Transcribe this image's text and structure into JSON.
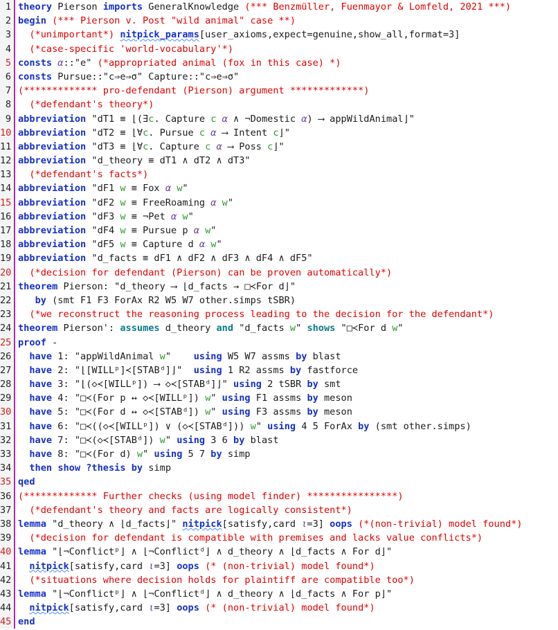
{
  "lines": [
    {
      "n": "1",
      "segs": [
        {
          "t": "theory",
          "c": "kw"
        },
        {
          "t": " Pierson "
        },
        {
          "t": "imports",
          "c": "kw"
        },
        {
          "t": " GeneralKnowledge "
        },
        {
          "t": "(*** Benzmüller, Fuenmayor & Lomfeld, 2021 ***)",
          "c": "cmt"
        }
      ]
    },
    {
      "n": "2",
      "segs": [
        {
          "t": "begin",
          "c": "kw"
        },
        {
          "t": " "
        },
        {
          "t": "(*** Pierson v. Post \"wild animal\" case **)",
          "c": "cmt"
        }
      ]
    },
    {
      "n": "3",
      "segs": [
        {
          "t": "  "
        },
        {
          "t": "(*unimportant*)",
          "c": "cmt"
        },
        {
          "t": " "
        },
        {
          "t": "nitpick_params",
          "c": "kw und"
        },
        {
          "t": "[user_axioms,expect=genuine,show_all,format=3]"
        }
      ]
    },
    {
      "n": "4",
      "segs": [
        {
          "t": "  "
        },
        {
          "t": "(*case-specific 'world-vocabulary'*)",
          "c": "cmt"
        }
      ]
    },
    {
      "n": "5",
      "hl": true,
      "segs": [
        {
          "t": "consts",
          "c": "kw"
        },
        {
          "t": " "
        },
        {
          "t": "α",
          "c": "fix"
        },
        {
          "t": "::\"e\" "
        },
        {
          "t": "(*appropriated animal (fox in this case) *)",
          "c": "cmt"
        }
      ]
    },
    {
      "n": "6",
      "segs": [
        {
          "t": "consts",
          "c": "kw"
        },
        {
          "t": " Pursue::\"c⇒e⇒σ\" Capture::\"c⇒e⇒σ\""
        }
      ]
    },
    {
      "n": "7",
      "segs": [
        {
          "t": "(************* pro-defendant (Pierson) argument *************)",
          "c": "cmt"
        }
      ]
    },
    {
      "n": "8",
      "segs": [
        {
          "t": "  "
        },
        {
          "t": "(*defendant's theory*)",
          "c": "cmt"
        }
      ]
    },
    {
      "n": "9",
      "segs": [
        {
          "t": "abbreviation",
          "c": "kw"
        },
        {
          "t": " \"dT1 ≡ ⌊(∃"
        },
        {
          "t": "c",
          "c": "var"
        },
        {
          "t": ". Capture "
        },
        {
          "t": "c",
          "c": "var"
        },
        {
          "t": " "
        },
        {
          "t": "α",
          "c": "fix"
        },
        {
          "t": " ∧ ¬Domestic "
        },
        {
          "t": "α",
          "c": "fix"
        },
        {
          "t": ") ⟶ appWildAnimal⌋\""
        }
      ]
    },
    {
      "n": "10",
      "hl": true,
      "segs": [
        {
          "t": "abbreviation",
          "c": "kw"
        },
        {
          "t": " \"dT2 ≡ ⌊∀"
        },
        {
          "t": "c",
          "c": "var"
        },
        {
          "t": ". Pursue "
        },
        {
          "t": "c",
          "c": "var"
        },
        {
          "t": " "
        },
        {
          "t": "α",
          "c": "fix"
        },
        {
          "t": " ⟶ Intent "
        },
        {
          "t": "c",
          "c": "var"
        },
        {
          "t": "⌋\""
        }
      ]
    },
    {
      "n": "11",
      "segs": [
        {
          "t": "abbreviation",
          "c": "kw"
        },
        {
          "t": " \"dT3 ≡ ⌊∀"
        },
        {
          "t": "c",
          "c": "var"
        },
        {
          "t": ". Capture "
        },
        {
          "t": "c",
          "c": "var"
        },
        {
          "t": " "
        },
        {
          "t": "α",
          "c": "fix"
        },
        {
          "t": " ⟶ Poss "
        },
        {
          "t": "c",
          "c": "var"
        },
        {
          "t": "⌋\""
        }
      ]
    },
    {
      "n": "12",
      "segs": [
        {
          "t": "abbreviation",
          "c": "kw"
        },
        {
          "t": " \"d_theory ≡ dT1 ∧ dT2 ∧ dT3\""
        }
      ]
    },
    {
      "n": "13",
      "segs": [
        {
          "t": "  "
        },
        {
          "t": "(*defendant's facts*)",
          "c": "cmt"
        }
      ]
    },
    {
      "n": "14",
      "segs": [
        {
          "t": "abbreviation",
          "c": "kw"
        },
        {
          "t": " \"dF1 "
        },
        {
          "t": "w",
          "c": "var"
        },
        {
          "t": " ≡ Fox "
        },
        {
          "t": "α",
          "c": "fix"
        },
        {
          "t": " "
        },
        {
          "t": "w",
          "c": "var"
        },
        {
          "t": "\""
        }
      ]
    },
    {
      "n": "15",
      "hl": true,
      "segs": [
        {
          "t": "abbreviation",
          "c": "kw"
        },
        {
          "t": " \"dF2 "
        },
        {
          "t": "w",
          "c": "var"
        },
        {
          "t": " ≡ FreeRoaming "
        },
        {
          "t": "α",
          "c": "fix"
        },
        {
          "t": " "
        },
        {
          "t": "w",
          "c": "var"
        },
        {
          "t": "\""
        }
      ]
    },
    {
      "n": "16",
      "segs": [
        {
          "t": "abbreviation",
          "c": "kw"
        },
        {
          "t": " \"dF3 "
        },
        {
          "t": "w",
          "c": "var"
        },
        {
          "t": " ≡ ¬Pet "
        },
        {
          "t": "α",
          "c": "fix"
        },
        {
          "t": " "
        },
        {
          "t": "w",
          "c": "var"
        },
        {
          "t": "\""
        }
      ]
    },
    {
      "n": "17",
      "segs": [
        {
          "t": "abbreviation",
          "c": "kw"
        },
        {
          "t": " \"dF4 "
        },
        {
          "t": "w",
          "c": "var"
        },
        {
          "t": " ≡ Pursue p "
        },
        {
          "t": "α",
          "c": "fix"
        },
        {
          "t": " "
        },
        {
          "t": "w",
          "c": "var"
        },
        {
          "t": "\""
        }
      ]
    },
    {
      "n": "18",
      "segs": [
        {
          "t": "abbreviation",
          "c": "kw"
        },
        {
          "t": " \"dF5 "
        },
        {
          "t": "w",
          "c": "var"
        },
        {
          "t": " ≡ Capture d "
        },
        {
          "t": "α",
          "c": "fix"
        },
        {
          "t": " "
        },
        {
          "t": "w",
          "c": "var"
        },
        {
          "t": "\""
        }
      ]
    },
    {
      "n": "19",
      "segs": [
        {
          "t": "abbreviation",
          "c": "kw"
        },
        {
          "t": " \"d_facts ≡ dF1 ∧ dF2 ∧ dF3 ∧ dF4 ∧ dF5\""
        }
      ]
    },
    {
      "n": "20",
      "hl": true,
      "segs": [
        {
          "t": "  "
        },
        {
          "t": "(*decision for defendant (Pierson) can be proven automatically*)",
          "c": "cmt"
        }
      ]
    },
    {
      "n": "21",
      "segs": [
        {
          "t": "theorem",
          "c": "kw"
        },
        {
          "t": " Pierson: \"d_theory ⟶ ⌊d_facts → □≺For d⌋\""
        }
      ]
    },
    {
      "n": "22",
      "segs": [
        {
          "t": "   "
        },
        {
          "t": "by",
          "c": "kw"
        },
        {
          "t": " (smt F1 F3 ForAx R2 W5 W7 other.simps tSBR)"
        }
      ]
    },
    {
      "n": "23",
      "segs": [
        {
          "t": "  "
        },
        {
          "t": "(*we reconstruct the reasoning process leading to the decision for the defendant*)",
          "c": "cmt"
        }
      ]
    },
    {
      "n": "24",
      "segs": [
        {
          "t": "theorem",
          "c": "kw"
        },
        {
          "t": " Pierson': "
        },
        {
          "t": "assumes",
          "c": "kw2"
        },
        {
          "t": " d_theory "
        },
        {
          "t": "and",
          "c": "kw2"
        },
        {
          "t": " \"d_facts "
        },
        {
          "t": "w",
          "c": "var"
        },
        {
          "t": "\" "
        },
        {
          "t": "shows",
          "c": "kw2"
        },
        {
          "t": " \"□≺For d "
        },
        {
          "t": "w",
          "c": "var"
        },
        {
          "t": "\""
        }
      ]
    },
    {
      "n": "25",
      "hl": true,
      "segs": [
        {
          "t": "proof",
          "c": "kw"
        },
        {
          "t": " -"
        }
      ]
    },
    {
      "n": "26",
      "segs": [
        {
          "t": "  "
        },
        {
          "t": "have",
          "c": "kw"
        },
        {
          "t": " 1: \"appWildAnimal "
        },
        {
          "t": "w",
          "c": "var"
        },
        {
          "t": "\"    "
        },
        {
          "t": "using",
          "c": "kw"
        },
        {
          "t": " W5 W7 assms "
        },
        {
          "t": "by",
          "c": "kw"
        },
        {
          "t": " blast"
        }
      ]
    },
    {
      "n": "27",
      "segs": [
        {
          "t": "  "
        },
        {
          "t": "have",
          "c": "kw"
        },
        {
          "t": " 2: \"⌊[WILLᵖ]≺[STABᵈ]⌋\"  "
        },
        {
          "t": "using",
          "c": "kw"
        },
        {
          "t": " 1 R2 assms "
        },
        {
          "t": "by",
          "c": "kw"
        },
        {
          "t": " fastforce"
        }
      ]
    },
    {
      "n": "28",
      "segs": [
        {
          "t": "  "
        },
        {
          "t": "have",
          "c": "kw"
        },
        {
          "t": " 3: \"⌊(◇≺[WILLᵖ]) ⟶ ◇≺[STABᵈ]⌋\" "
        },
        {
          "t": "using",
          "c": "kw"
        },
        {
          "t": " 2 tSBR "
        },
        {
          "t": "by",
          "c": "kw"
        },
        {
          "t": " smt"
        }
      ]
    },
    {
      "n": "29",
      "segs": [
        {
          "t": "  "
        },
        {
          "t": "have",
          "c": "kw"
        },
        {
          "t": " 4: \"□≺(For p ↔ ◇≺[WILLᵖ]) "
        },
        {
          "t": "w",
          "c": "var"
        },
        {
          "t": "\" "
        },
        {
          "t": "using",
          "c": "kw"
        },
        {
          "t": " F1 assms "
        },
        {
          "t": "by",
          "c": "kw"
        },
        {
          "t": " meson"
        }
      ]
    },
    {
      "n": "30",
      "hl": true,
      "segs": [
        {
          "t": "  "
        },
        {
          "t": "have",
          "c": "kw"
        },
        {
          "t": " 5: \"□≺(For d ↔ ◇≺[STABᵈ]) "
        },
        {
          "t": "w",
          "c": "var"
        },
        {
          "t": "\" "
        },
        {
          "t": "using",
          "c": "kw"
        },
        {
          "t": " F3 assms "
        },
        {
          "t": "by",
          "c": "kw"
        },
        {
          "t": " meson"
        }
      ]
    },
    {
      "n": "31",
      "segs": [
        {
          "t": "  "
        },
        {
          "t": "have",
          "c": "kw"
        },
        {
          "t": " 6: \"□≺((◇≺[WILLᵖ]) ∨ (◇≺[STABᵈ])) "
        },
        {
          "t": "w",
          "c": "var"
        },
        {
          "t": "\" "
        },
        {
          "t": "using",
          "c": "kw"
        },
        {
          "t": " 4 5 ForAx "
        },
        {
          "t": "by",
          "c": "kw"
        },
        {
          "t": " (smt other.simps)"
        }
      ]
    },
    {
      "n": "32",
      "segs": [
        {
          "t": "  "
        },
        {
          "t": "have",
          "c": "kw"
        },
        {
          "t": " 7: \"□≺(◇≺[STABᵈ]) "
        },
        {
          "t": "w",
          "c": "var"
        },
        {
          "t": "\" "
        },
        {
          "t": "using",
          "c": "kw"
        },
        {
          "t": " 3 6 "
        },
        {
          "t": "by",
          "c": "kw"
        },
        {
          "t": " blast"
        }
      ]
    },
    {
      "n": "33",
      "segs": [
        {
          "t": "  "
        },
        {
          "t": "have",
          "c": "kw"
        },
        {
          "t": " 8: \"□≺(For d) "
        },
        {
          "t": "w",
          "c": "var"
        },
        {
          "t": "\" "
        },
        {
          "t": "using",
          "c": "kw"
        },
        {
          "t": " 5 7 "
        },
        {
          "t": "by",
          "c": "kw"
        },
        {
          "t": " simp"
        }
      ]
    },
    {
      "n": "34",
      "segs": [
        {
          "t": "  "
        },
        {
          "t": "then",
          "c": "kw"
        },
        {
          "t": " "
        },
        {
          "t": "show",
          "c": "kw"
        },
        {
          "t": " "
        },
        {
          "t": "?thesis",
          "c": "kw"
        },
        {
          "t": " "
        },
        {
          "t": "by",
          "c": "kw"
        },
        {
          "t": " simp"
        }
      ]
    },
    {
      "n": "35",
      "hl": true,
      "segs": [
        {
          "t": "qed",
          "c": "kw"
        }
      ]
    },
    {
      "n": "36",
      "segs": [
        {
          "t": "(************* Further checks (using model finder) ****************)",
          "c": "cmt"
        }
      ]
    },
    {
      "n": "37",
      "segs": [
        {
          "t": "  "
        },
        {
          "t": "(*defendant's theory and facts are logically consistent*)",
          "c": "cmt"
        }
      ]
    },
    {
      "n": "38",
      "segs": [
        {
          "t": "lemma",
          "c": "kw"
        },
        {
          "t": " \"d_theory ∧ ⌊d_facts⌋\" "
        },
        {
          "t": "nitpick",
          "c": "kw und"
        },
        {
          "t": "[satisfy,card "
        },
        {
          "t": "ι",
          "c": "fix"
        },
        {
          "t": "=3] "
        },
        {
          "t": "oops",
          "c": "kw"
        },
        {
          "t": " "
        },
        {
          "t": "(*(non-trivial) model found*)",
          "c": "cmt"
        }
      ]
    },
    {
      "n": "39",
      "segs": [
        {
          "t": "  "
        },
        {
          "t": "(*decision for defendant is compatible with premises and lacks value conflicts*)",
          "c": "cmt"
        }
      ]
    },
    {
      "n": "40",
      "hl": true,
      "segs": [
        {
          "t": "lemma",
          "c": "kw"
        },
        {
          "t": " \"⌊¬Conflictᵖ⌋ ∧ ⌊¬Conflictᵈ⌋ ∧ d_theory ∧ ⌊d_facts ∧ For d⌋\""
        }
      ]
    },
    {
      "n": "41",
      "segs": [
        {
          "t": "  "
        },
        {
          "t": "nitpick",
          "c": "kw und"
        },
        {
          "t": "[satisfy,card "
        },
        {
          "t": "ι",
          "c": "fix"
        },
        {
          "t": "=3] "
        },
        {
          "t": "oops",
          "c": "kw"
        },
        {
          "t": " "
        },
        {
          "t": "(* (non-trivial) model found*)",
          "c": "cmt"
        }
      ]
    },
    {
      "n": "42",
      "segs": [
        {
          "t": "  "
        },
        {
          "t": "(*situations where decision holds for plaintiff are compatible too*)",
          "c": "cmt"
        }
      ]
    },
    {
      "n": "43",
      "segs": [
        {
          "t": "lemma",
          "c": "kw"
        },
        {
          "t": " \"⌊¬Conflictᵖ⌋ ∧ ⌊¬Conflictᵈ⌋ ∧ d_theory ∧ ⌊d_facts ∧ For p⌋\""
        }
      ]
    },
    {
      "n": "44",
      "segs": [
        {
          "t": "  "
        },
        {
          "t": "nitpick",
          "c": "kw und"
        },
        {
          "t": "[satisfy,card "
        },
        {
          "t": "ι",
          "c": "fix"
        },
        {
          "t": "=3] "
        },
        {
          "t": "oops",
          "c": "kw"
        },
        {
          "t": " "
        },
        {
          "t": "(* (non-trivial) model found*)",
          "c": "cmt"
        }
      ]
    },
    {
      "n": "45",
      "hl": true,
      "segs": [
        {
          "t": "end",
          "c": "kw"
        }
      ]
    }
  ]
}
